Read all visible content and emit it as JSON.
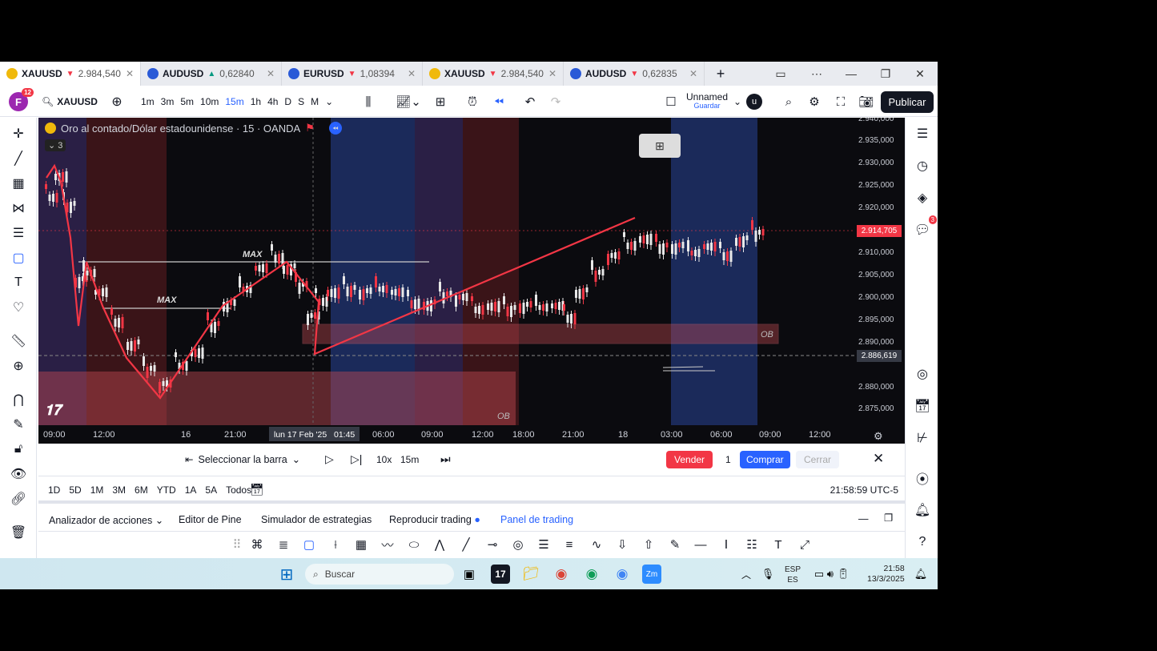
{
  "tabs": [
    {
      "symbol": "XAUUSD",
      "direction": "down",
      "value": "2.984,540",
      "active": true,
      "color": "#f0b90b"
    },
    {
      "symbol": "AUDUSD",
      "direction": "up",
      "value": "0,62840",
      "active": false,
      "color": "#2a5ad7"
    },
    {
      "symbol": "EURUSD",
      "direction": "down",
      "value": "1,08394",
      "active": false,
      "color": "#2a5ad7"
    },
    {
      "symbol": "XAUUSD",
      "direction": "down",
      "value": "2.984,540",
      "active": false,
      "color": "#f0b90b"
    },
    {
      "symbol": "AUDUSD",
      "direction": "down",
      "value": "0,62835",
      "active": false,
      "color": "#2a5ad7"
    }
  ],
  "toolbar": {
    "avatar_letter": "F",
    "avatar_badge": "12",
    "symbol": "XAUUSD",
    "intervals": [
      "1m",
      "3m",
      "5m",
      "10m",
      "15m",
      "1h",
      "4h",
      "D",
      "S",
      "M"
    ],
    "selected_interval": "15m",
    "layout_name": "Unnamed",
    "layout_sub": "Guardar",
    "user_letter": "u",
    "publish_label": "Publicar"
  },
  "chart": {
    "legend_title": "Oro al contado/Dólar estadounidense · 15 · OANDA",
    "indicator_count": "3",
    "price_labels": [
      "2.940,000",
      "2.935,000",
      "2.930,000",
      "2.925,000",
      "2.920,000",
      "2.910,000",
      "2.905,000",
      "2.900,000",
      "2.895,000",
      "2.890,000",
      "2.880,000",
      "2.875,000"
    ],
    "current_price": "2.914,705",
    "crosshair_price": "2.886,619",
    "annotations": {
      "max_upper": "MAX",
      "max_lower": "MAX",
      "ob_upper": "OB",
      "ob_lower": "OB"
    },
    "time_labels": [
      "09:00",
      "12:00",
      "16",
      "21:00",
      "06:00",
      "09:00",
      "12:00",
      "18:00",
      "21:00",
      "18",
      "03:00",
      "06:00",
      "09:00",
      "12:00"
    ],
    "crosshair_time": "lun 17 Feb '25",
    "crosshair_time2": "01:45"
  },
  "replay": {
    "select_bar_label": "Seleccionar la barra",
    "speed": "10x",
    "interval": "15m",
    "sell_label": "Vender",
    "qty": "1",
    "buy_label": "Comprar",
    "close_label": "Cerrar"
  },
  "ranges": {
    "items": [
      "1D",
      "5D",
      "1M",
      "3M",
      "6M",
      "YTD",
      "1A",
      "5A",
      "Todos"
    ],
    "clock": "21:58:59 UTC-5"
  },
  "bottom_tabs": [
    {
      "label": "Analizador de acciones"
    },
    {
      "label": "Editor de Pine"
    },
    {
      "label": "Simulador de estrategias"
    },
    {
      "label": "Reproducir trading"
    },
    {
      "label": "Panel de trading"
    }
  ],
  "taskbar": {
    "search_placeholder": "Buscar",
    "lang1": "ESP",
    "lang2": "ES",
    "time": "21:58",
    "date": "13/3/2025",
    "right_badge": "3"
  },
  "colors": {
    "red": "#f23645",
    "blue": "#2962ff",
    "green": "#089981",
    "dark": "#131722"
  }
}
